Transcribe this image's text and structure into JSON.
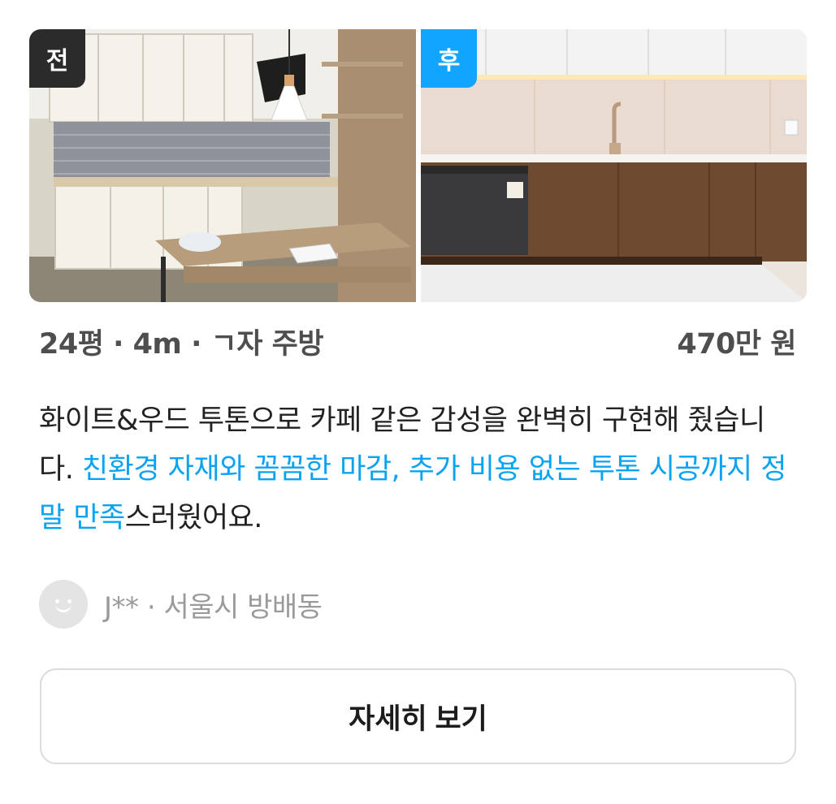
{
  "card": {
    "before_badge": "전",
    "after_badge": "후",
    "summary": "24평 · 4m · ㄱ자 주방",
    "price": "470만 원",
    "review": {
      "part1": "화이트&우드 투톤으로 카페 같은 감성을 완벽히 구현해 줬습니다. ",
      "highlight": "친환경 자재와 꼼꼼한 마감, 추가 비용 없는 투톤 시공까지 정말 만족",
      "part2": "스러웠어요."
    },
    "author": "J** · 서울시 방배동",
    "detail_button": "자세히 보기"
  },
  "colors": {
    "accent": "#0aa3f2",
    "badge_before": "#2b2b2b",
    "badge_after": "#12a5ff",
    "meta_text": "#4e4e4e",
    "author_text": "#9a9a9a"
  },
  "icons": {
    "avatar": "smiley-face-icon"
  }
}
